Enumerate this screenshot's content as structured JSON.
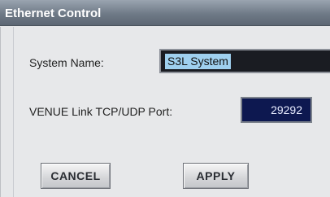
{
  "dialog": {
    "title": "Ethernet Control"
  },
  "system_name": {
    "label": "System Name:",
    "value": "S3L System"
  },
  "port": {
    "label": "VENUE Link TCP/UDP Port:",
    "value": "29292"
  },
  "buttons": {
    "cancel": "CANCEL",
    "apply": "APPLY"
  },
  "colors": {
    "titlebar": "#6f7a87",
    "panel": "#e7e8ea",
    "field_dark": "#1a1c22",
    "port_field": "#0d1850",
    "selection": "#9fd0ef"
  }
}
